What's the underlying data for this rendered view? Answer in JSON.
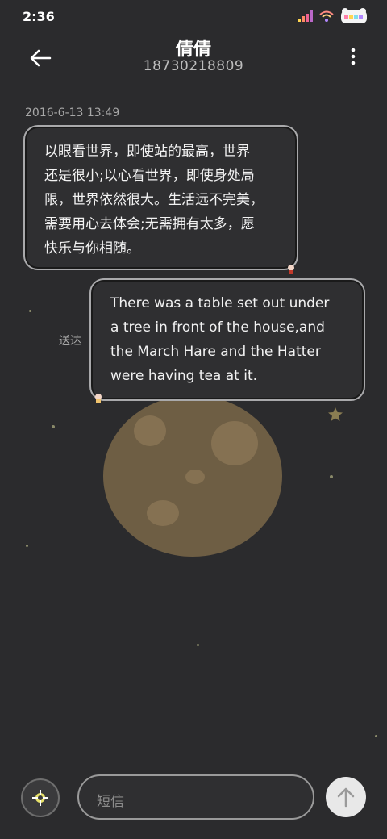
{
  "status_bar": {
    "time": "2:36"
  },
  "header": {
    "contact_name": "倩倩",
    "phone_number": "18730218809"
  },
  "thread": {
    "timestamp": "2016-6-13 13:49",
    "messages": [
      {
        "direction": "incoming",
        "text": "以眼看世界，即使站的最高，世界\n还是很小;以心看世界，即使身处局\n限，世界依然很大。生活远不完美，\n需要用心去体会;无需拥有太多，愿\n快乐与你相随。"
      },
      {
        "direction": "outgoing",
        "text": "There was a table set out under\na tree in front of the house,and\nthe March Hare and the Hatter\nwere having tea at it.",
        "status": "送达"
      }
    ]
  },
  "composer": {
    "placeholder": "短信"
  },
  "icons": {
    "back": "arrow-left-icon",
    "menu": "more-vertical-icon",
    "attach": "add-attachment-icon",
    "send": "arrow-up-icon"
  }
}
